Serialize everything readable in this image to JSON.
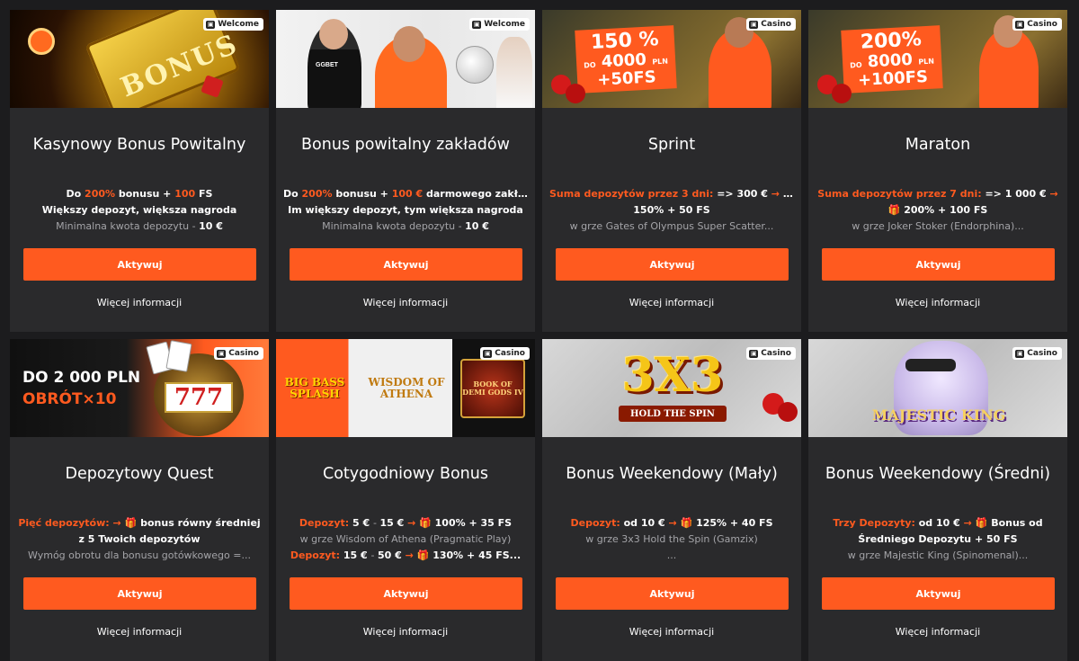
{
  "common": {
    "activate_label": "Aktywuj",
    "more_label": "Więcej informacji"
  },
  "cards": [
    {
      "badge": "Welcome",
      "badge_icon": "gift-icon",
      "title": "Kasynowy Bonus Powitalny",
      "lines": [
        {
          "segments": [
            {
              "t": "Do ",
              "c": ""
            },
            {
              "t": "200%",
              "c": "o"
            },
            {
              "t": " bonusu + ",
              "c": ""
            },
            {
              "t": "100",
              "c": "o"
            },
            {
              "t": " FS",
              "c": ""
            }
          ]
        },
        {
          "segments": [
            {
              "t": "Większy depozyt, większa nagroda",
              "c": ""
            }
          ]
        },
        {
          "segments": [
            {
              "t": "Minimalna kwota depozytu - ",
              "c": "muted"
            },
            {
              "t": "10 €",
              "c": "mutedb"
            }
          ]
        }
      ],
      "banner_text": "BONUS"
    },
    {
      "badge": "Welcome",
      "badge_icon": "gift-icon",
      "title": "Bonus powitalny zakładów",
      "lines": [
        {
          "segments": [
            {
              "t": "Do ",
              "c": ""
            },
            {
              "t": "200%",
              "c": "o"
            },
            {
              "t": " bonusu + ",
              "c": ""
            },
            {
              "t": "100 €",
              "c": "o"
            },
            {
              "t": " darmowego zakładu",
              "c": ""
            }
          ]
        },
        {
          "segments": [
            {
              "t": "Im większy depozyt, tym większa nagroda",
              "c": ""
            }
          ]
        },
        {
          "segments": [
            {
              "t": "Minimalna kwota depozytu - ",
              "c": "muted"
            },
            {
              "t": "10 €",
              "c": "mutedb"
            }
          ]
        }
      ],
      "banner_text": "GGBET"
    },
    {
      "badge": "Casino",
      "badge_icon": "casino-icon",
      "title": "Sprint",
      "lines": [
        {
          "segments": [
            {
              "t": "Suma depozytów przez 3 dni:",
              "c": "o"
            },
            {
              "t": " => 300 € ",
              "c": ""
            },
            {
              "t": "→",
              "c": "o"
            },
            {
              "t": " 🎁",
              "c": "gift"
            }
          ]
        },
        {
          "segments": [
            {
              "t": "150% + 50 FS",
              "c": ""
            }
          ]
        },
        {
          "segments": [
            {
              "t": "w grze Gates of Olympus Super Scatter...",
              "c": "muted"
            }
          ]
        }
      ],
      "promo": {
        "big": "150 %",
        "small": "DO",
        "mid": "4000",
        "unit": "PLN",
        "fs": "+50FS"
      }
    },
    {
      "badge": "Casino",
      "badge_icon": "casino-icon",
      "title": "Maraton",
      "lines": [
        {
          "segments": [
            {
              "t": "Suma depozytów przez 7 dni:",
              "c": "o"
            },
            {
              "t": " => 1 000 € ",
              "c": ""
            },
            {
              "t": "→",
              "c": "o"
            }
          ]
        },
        {
          "segments": [
            {
              "t": "🎁",
              "c": "gift"
            },
            {
              "t": " 200% + 100 FS",
              "c": ""
            }
          ]
        },
        {
          "segments": [
            {
              "t": "w grze Joker Stoker (Endorphina)...",
              "c": "muted"
            }
          ]
        }
      ],
      "promo": {
        "big": "200%",
        "small": "DO",
        "mid": "8000",
        "unit": "PLN",
        "fs": "+100FS"
      }
    },
    {
      "badge": "Casino",
      "badge_icon": "casino-icon",
      "title": "Depozytowy Quest",
      "lines": [
        {
          "segments": [
            {
              "t": "Pięć depozytów:",
              "c": "o"
            },
            {
              "t": " → ",
              "c": "o"
            },
            {
              "t": "🎁",
              "c": "gift"
            },
            {
              "t": " bonus równy średniej",
              "c": ""
            }
          ]
        },
        {
          "segments": [
            {
              "t": "z 5 Twoich depozytów",
              "c": ""
            }
          ]
        },
        {
          "segments": [
            {
              "t": "Wymóg obrotu dla bonusu gotówkowego =...",
              "c": "muted"
            }
          ]
        }
      ],
      "banner_line1": "DO 2 000 PLN",
      "banner_line2": "OBRÓT×10",
      "slot_text": "777"
    },
    {
      "badge": "Casino",
      "badge_icon": "casino-icon",
      "title": "Cotygodniowy Bonus",
      "lines": [
        {
          "segments": [
            {
              "t": "Depozyt:",
              "c": "o"
            },
            {
              "t": " 5 € ",
              "c": ""
            },
            {
              "t": "- ",
              "c": "muted"
            },
            {
              "t": "15 € ",
              "c": ""
            },
            {
              "t": "→",
              "c": "o"
            },
            {
              "t": " 🎁",
              "c": "gift"
            },
            {
              "t": " 100% + 35 FS",
              "c": ""
            }
          ]
        },
        {
          "segments": [
            {
              "t": "w grze Wisdom of Athena (Pragmatic Play)",
              "c": "muted"
            }
          ]
        },
        {
          "segments": [
            {
              "t": "Depozyt:",
              "c": "o"
            },
            {
              "t": " 15 € ",
              "c": ""
            },
            {
              "t": "- ",
              "c": "muted"
            },
            {
              "t": "50 € ",
              "c": ""
            },
            {
              "t": "→",
              "c": "o"
            },
            {
              "t": " 🎁",
              "c": "gift"
            },
            {
              "t": " 130% + 45 FS...",
              "c": ""
            }
          ]
        }
      ],
      "games": [
        "BIG BASS SPLASH",
        "WISDOM OF ATHENA",
        "BOOK OF DEMI GODS IV"
      ]
    },
    {
      "badge": "Casino",
      "badge_icon": "casino-icon",
      "title": "Bonus Weekendowy (Mały)",
      "lines": [
        {
          "segments": [
            {
              "t": "Depozyt:",
              "c": "o"
            },
            {
              "t": " od 10 € ",
              "c": ""
            },
            {
              "t": "→",
              "c": "o"
            },
            {
              "t": " 🎁",
              "c": "gift"
            },
            {
              "t": " 125% + 40 FS",
              "c": ""
            }
          ]
        },
        {
          "segments": [
            {
              "t": "w grze 3x3 Hold the Spin (Gamzix)",
              "c": "muted"
            }
          ]
        },
        {
          "segments": [
            {
              "t": "...",
              "c": "muted"
            }
          ]
        }
      ],
      "game_title": "3X3",
      "game_sub": "HOLD THE SPIN"
    },
    {
      "badge": "Casino",
      "badge_icon": "casino-icon",
      "title": "Bonus Weekendowy (Średni)",
      "lines": [
        {
          "segments": [
            {
              "t": "Trzy Depozyty:",
              "c": "o"
            },
            {
              "t": " od 10 € ",
              "c": ""
            },
            {
              "t": "→",
              "c": "o"
            },
            {
              "t": " 🎁",
              "c": "gift"
            },
            {
              "t": " Bonus od",
              "c": ""
            }
          ]
        },
        {
          "segments": [
            {
              "t": "Średniego Depozytu + 50 FS",
              "c": ""
            }
          ]
        },
        {
          "segments": [
            {
              "t": "w grze Majestic King (Spinomenal)...",
              "c": "muted"
            }
          ]
        }
      ],
      "game_title": "MAJESTIC KING"
    }
  ]
}
